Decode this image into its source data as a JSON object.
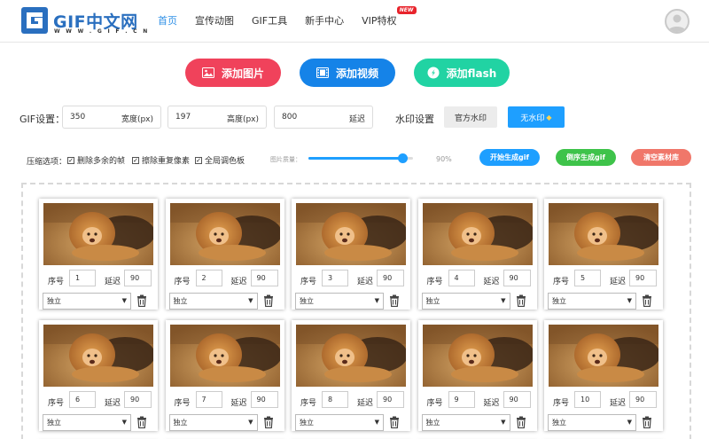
{
  "brand": {
    "name": "GIF中文网",
    "domain": "W W W . G I F . C N"
  },
  "nav": [
    {
      "label": "首页",
      "active": true
    },
    {
      "label": "宣传动图",
      "active": false
    },
    {
      "label": "GIF工具",
      "active": false
    },
    {
      "label": "新手中心",
      "active": false
    },
    {
      "label": "VIP特权",
      "active": false,
      "badge": "NEW"
    }
  ],
  "actions": {
    "add_image": "添加图片",
    "add_video": "添加视频",
    "add_flash": "添加flash"
  },
  "gif_settings": {
    "label": "GIF设置：",
    "width_value": "350",
    "width_unit": "宽度(px)",
    "height_value": "197",
    "height_unit": "高度(px)",
    "delay_value": "800",
    "delay_unit": "延迟"
  },
  "watermark": {
    "label": "水印设置",
    "official": "官方水印",
    "none": "无水印"
  },
  "compression": {
    "label": "压缩选项：",
    "options": [
      {
        "label": "删除多余的帧",
        "checked": true
      },
      {
        "label": "擦除重复像素",
        "checked": true
      },
      {
        "label": "全局调色板",
        "checked": true
      }
    ],
    "quality_label": "图片质量：",
    "quality_value": "90%",
    "quality_fraction": 0.9
  },
  "controls": {
    "start": "开始生成gif",
    "reverse": "倒序生成gif",
    "clear": "清空素材库"
  },
  "frame_labels": {
    "seq": "序号",
    "delay": "延迟",
    "mode": "独立"
  },
  "frames": [
    {
      "seq": "1",
      "delay": "90"
    },
    {
      "seq": "2",
      "delay": "90"
    },
    {
      "seq": "3",
      "delay": "90"
    },
    {
      "seq": "4",
      "delay": "90"
    },
    {
      "seq": "5",
      "delay": "90"
    },
    {
      "seq": "6",
      "delay": "90"
    },
    {
      "seq": "7",
      "delay": "90"
    },
    {
      "seq": "8",
      "delay": "90"
    },
    {
      "seq": "9",
      "delay": "90"
    },
    {
      "seq": "10",
      "delay": "90"
    }
  ],
  "colors": {
    "accent": "#1e9fff",
    "image_btn": "#f0425b",
    "video_btn": "#1583e8",
    "flash_btn": "#21d3a3"
  }
}
